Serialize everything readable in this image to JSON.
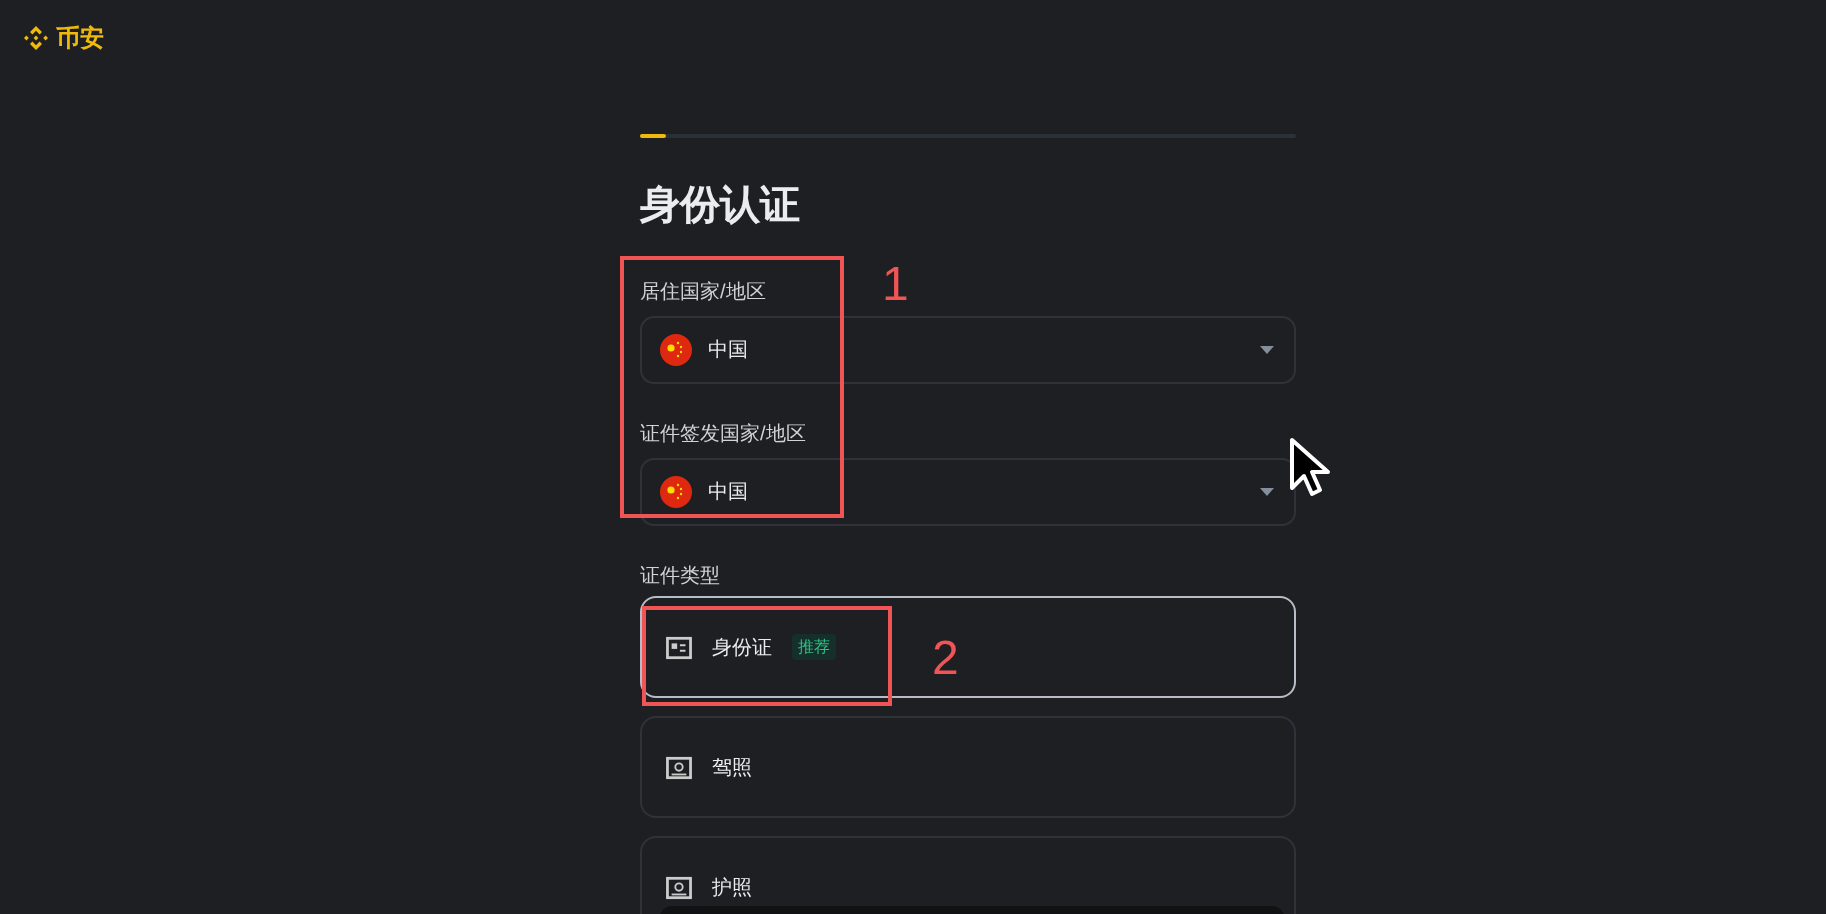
{
  "brand": {
    "name": "币安"
  },
  "progress": {
    "level": 0.04
  },
  "title": "身份认证",
  "fields": [
    {
      "label": "居住国家/地区",
      "value": "中国"
    },
    {
      "label": "证件签发国家/地区",
      "value": "中国"
    }
  ],
  "document_type": {
    "label": "证件类型",
    "options": [
      {
        "label": "身份证",
        "badge": "推荐",
        "selected": true
      },
      {
        "label": "驾照",
        "selected": false
      },
      {
        "label": "护照",
        "selected": false
      }
    ]
  },
  "annotations": [
    {
      "number": "1"
    },
    {
      "number": "2"
    }
  ]
}
